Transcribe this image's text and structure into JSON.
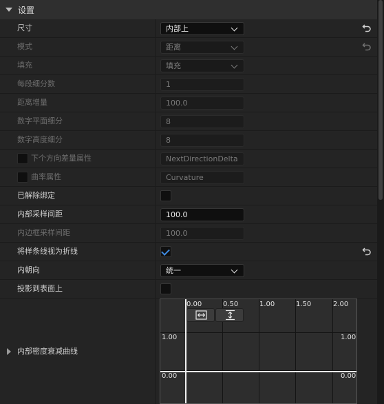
{
  "section": {
    "title": "设置"
  },
  "rows": {
    "size": {
      "label": "尺寸",
      "value": "内部上"
    },
    "mode": {
      "label": "模式",
      "value": "距离"
    },
    "fill": {
      "label": "填充",
      "value": "填充"
    },
    "subdiv_per_segment": {
      "label": "每段细分数",
      "value": "1"
    },
    "distance_increment": {
      "label": "距离增量",
      "value": "100.0"
    },
    "digital_plane_subdiv": {
      "label": "数字平面细分",
      "value": "8"
    },
    "digital_height_subdiv": {
      "label": "数字高度细分",
      "value": "8"
    },
    "next_direction_attr": {
      "label": "下个方向差量属性",
      "value": "NextDirectionDelta"
    },
    "curvature_attr": {
      "label": "曲率属性",
      "value": "Curvature"
    },
    "unbound": {
      "label": "已解除绑定"
    },
    "inner_sample_spacing": {
      "label": "内部采样间距",
      "value": "100.0"
    },
    "inner_border_spacing": {
      "label": "内边框采样间距",
      "value": "100.0"
    },
    "treat_spline_polyline": {
      "label": "将样条线视为折线"
    },
    "inner_orientation": {
      "label": "内朝向",
      "value": "统一"
    },
    "project_to_surface": {
      "label": "投影到表面上"
    },
    "density_falloff_curve": {
      "label": "内部密度衰减曲线"
    }
  },
  "curve_graph": {
    "x_ticks": [
      "0.00",
      "0.50",
      "1.00",
      "1.50",
      "2.00"
    ],
    "y_left_top": "1.00",
    "y_right_top": "1.00",
    "y_left_bottom": "0.00",
    "y_right_bottom": "0.00",
    "fit_horizontal_icon": "fit-horizontal-icon",
    "fit_vertical_icon": "fit-vertical-icon"
  },
  "colors": {
    "accent": "#3f8ae0",
    "panel": "#242424",
    "header": "#2f2f2f",
    "field": "#0f0f0f"
  }
}
